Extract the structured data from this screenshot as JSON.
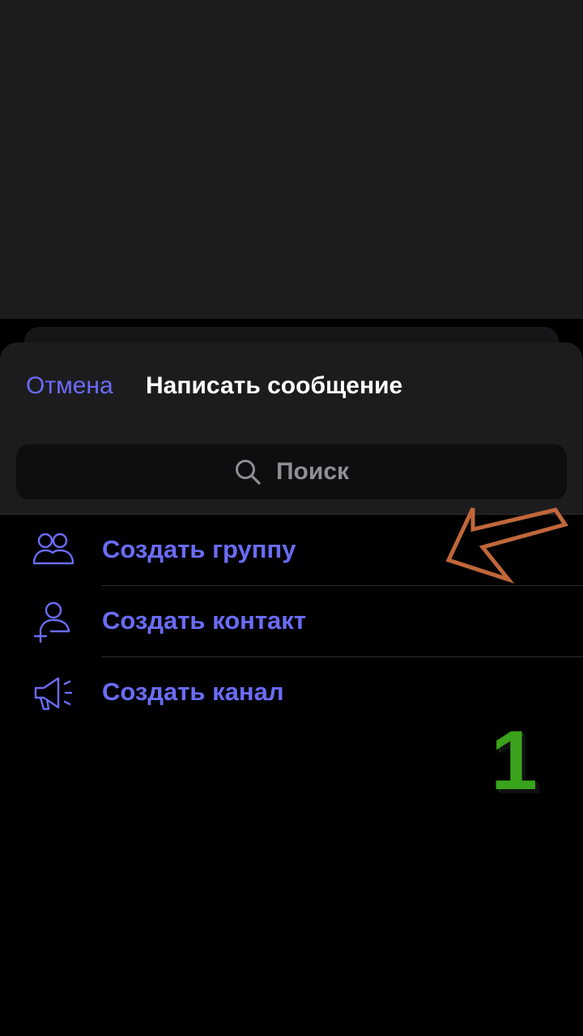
{
  "header": {
    "cancel_label": "Отмена",
    "title": "Написать сообщение"
  },
  "search": {
    "placeholder": "Поиск",
    "icon": "search-icon"
  },
  "menu": {
    "items": [
      {
        "label": "Создать группу",
        "icon": "group-icon"
      },
      {
        "label": "Создать контакт",
        "icon": "add-contact-icon"
      },
      {
        "label": "Создать канал",
        "icon": "megaphone-icon"
      }
    ]
  },
  "annotation": {
    "step_number": "1",
    "arrow_color": "#c0673a",
    "number_color": "#3aa31c"
  },
  "colors": {
    "accent": "#6a6cf6",
    "sheet_bg": "#1c1c1e",
    "list_bg": "#000000"
  }
}
